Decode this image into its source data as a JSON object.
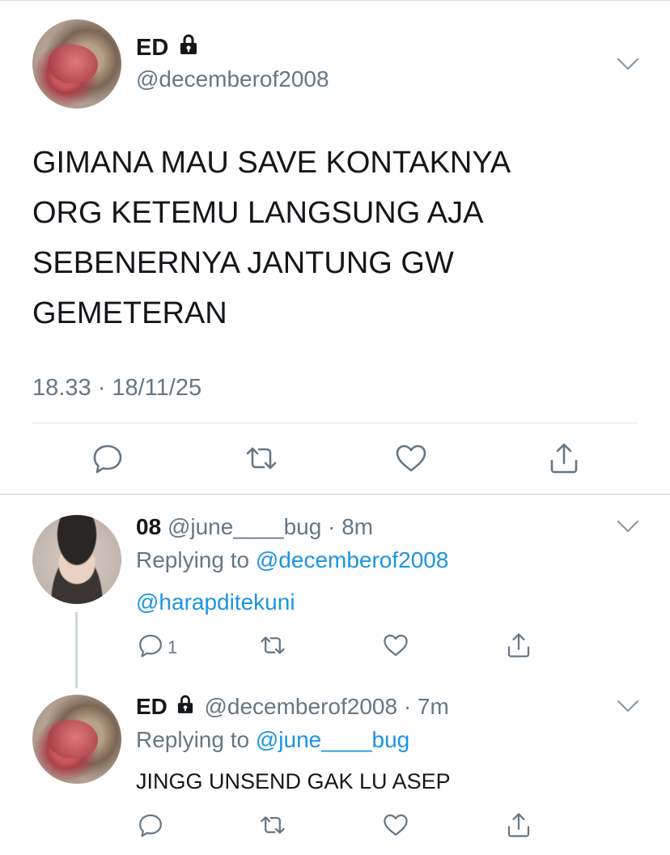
{
  "main_tweet": {
    "name": "ED",
    "handle": "@decemberof2008",
    "lines": [
      "GIMANA MAU SAVE KONTAKNYA",
      "ORG KETEMU LANGSUNG AJA",
      "SEBENERNYA JANTUNG GW",
      "GEMETERAN"
    ],
    "timestamp": "18.33 · 18/11/25",
    "icons": [
      "reply-icon",
      "retweet-icon",
      "like-icon",
      "share-icon"
    ]
  },
  "replies": [
    {
      "name": "08",
      "handle": "@june____bug",
      "time": "· 8m",
      "replying_prefix": "Replying to ",
      "replying_to": "@decemberof2008",
      "body": "@harapditekuni",
      "reply_count": "1"
    },
    {
      "name": "ED",
      "handle": "@decemberof2008",
      "time": "· 7m",
      "replying_prefix": "Replying to ",
      "replying_to": "@june____bug",
      "body": "JINGG UNSEND GAK LU ASEP",
      "reply_count": ""
    }
  ],
  "colors": {
    "text": "#14171a",
    "secondary": "#657786",
    "link": "#1b95e0",
    "divider": "#e1e8ed"
  }
}
